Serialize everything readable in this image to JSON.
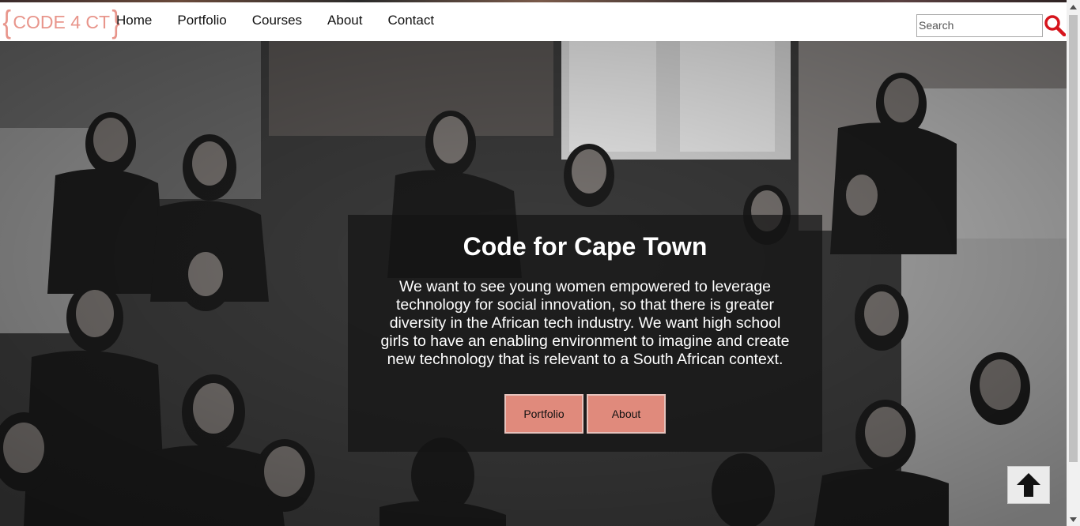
{
  "brand": {
    "logo_text": "CODE 4 CT",
    "logo_color": "#e8958b"
  },
  "nav": {
    "items": [
      {
        "label": "Home"
      },
      {
        "label": "Portfolio"
      },
      {
        "label": "Courses"
      },
      {
        "label": "About"
      },
      {
        "label": "Contact"
      }
    ]
  },
  "search": {
    "placeholder": "Search",
    "icon": "search-icon",
    "icon_color": "#d6141c"
  },
  "hero": {
    "title": "Code for Cape Town",
    "text": "We want to see young women empowered to leverage technology for social innovation, so that there is greater diversity in the African tech industry. We want high school girls to have an enabling environment to imagine and create new technology that is relevant to a South African context.",
    "buttons": {
      "portfolio": "Portfolio",
      "about": "About"
    },
    "button_color": "#e08a7c"
  },
  "back_to_top": {
    "icon": "arrow-up-icon"
  }
}
